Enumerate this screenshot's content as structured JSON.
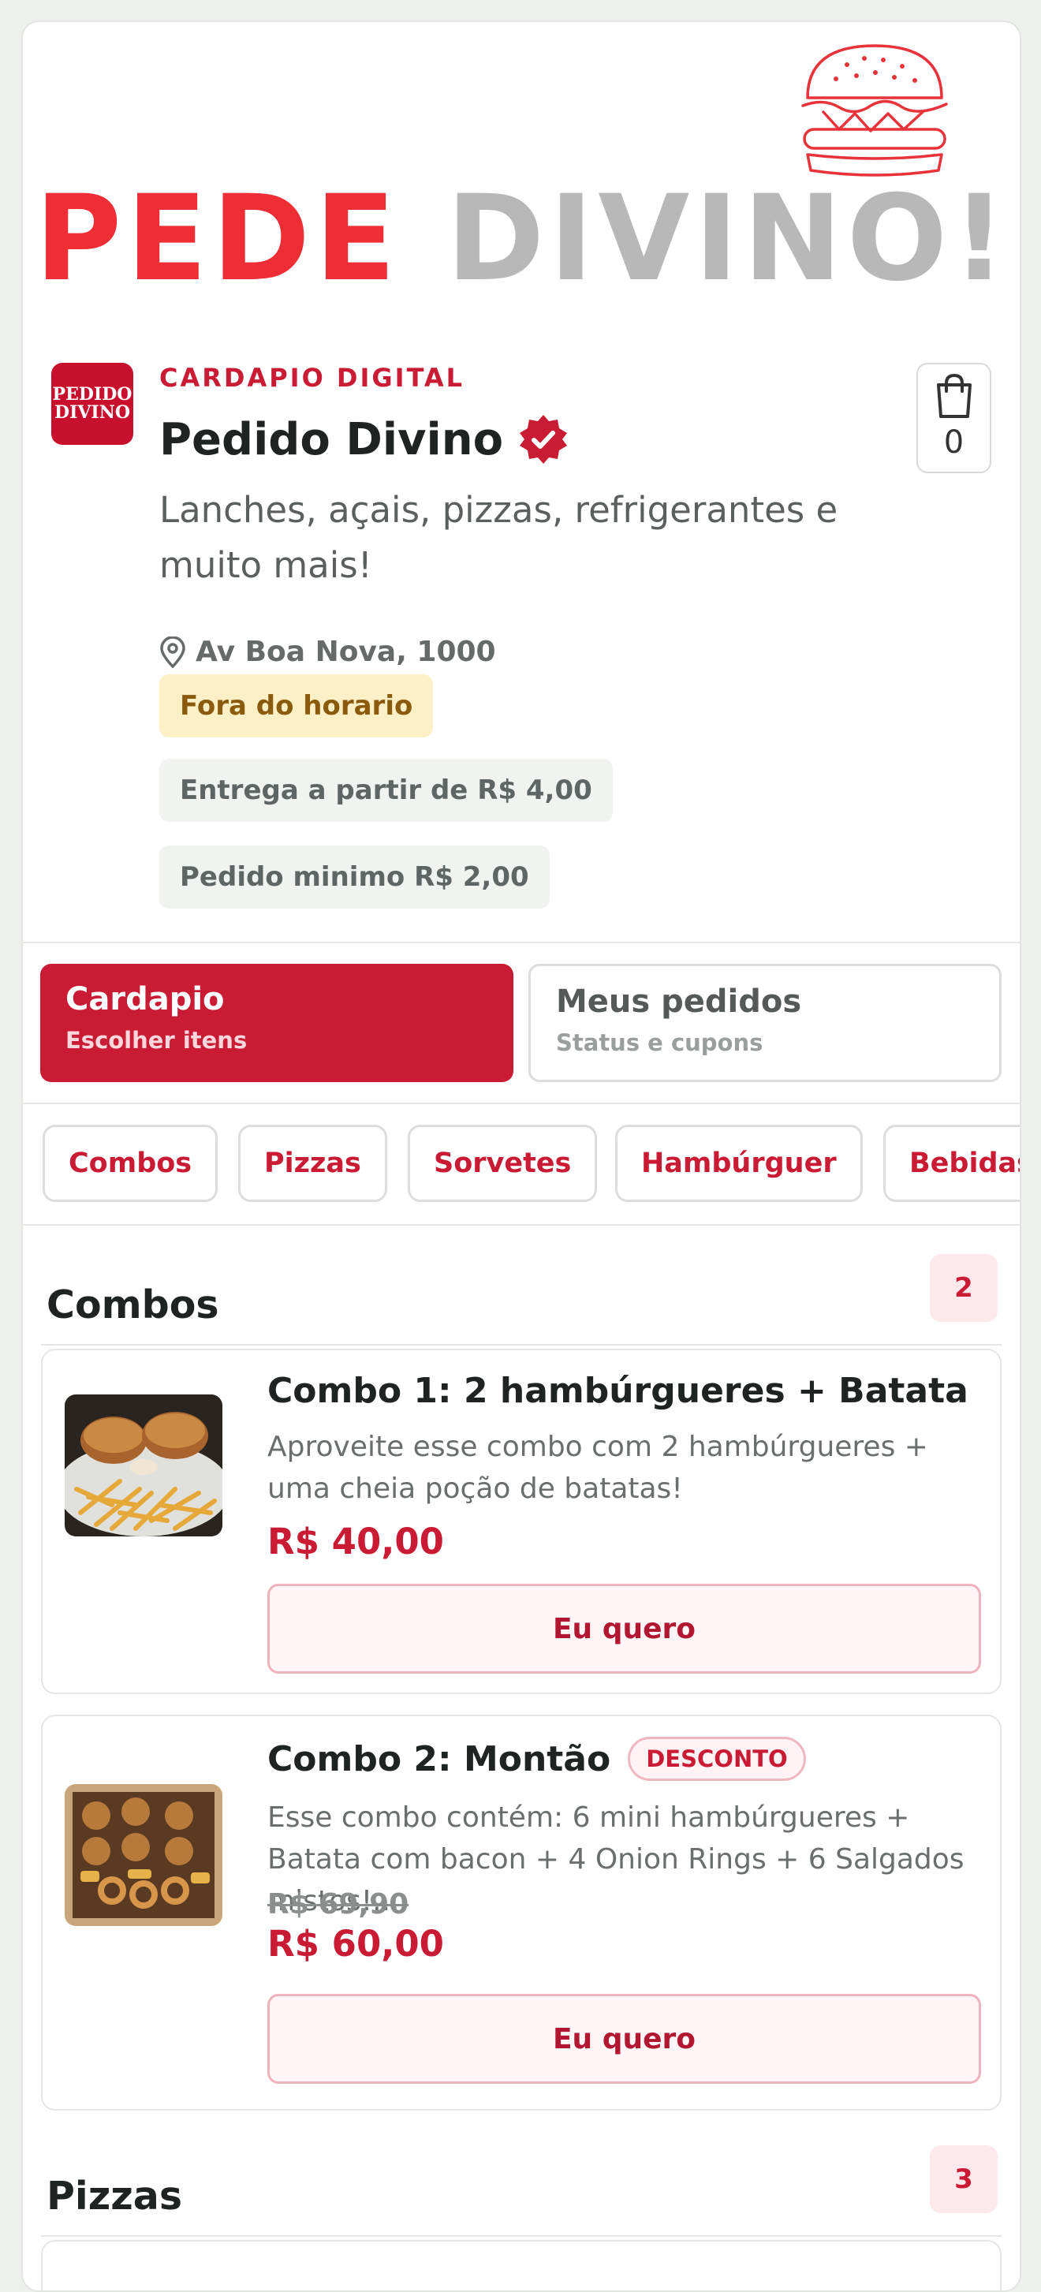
{
  "brand": {
    "word1": "PEDE",
    "word2": "DIVINO!",
    "red": "#ee2d35",
    "grey": "#b8b8b8",
    "logo_line1": "PEDIDO",
    "logo_line2": "DIVINO"
  },
  "store": {
    "eyebrow": "CARDAPIO DIGITAL",
    "name": "Pedido Divino",
    "description": "Lanches, açais, pizzas, refrigerantes e muito mais!",
    "address": "Av Boa Nova, 1000",
    "status": "Fora do horario",
    "delivery": "Entrega a partir de R$ 4,00",
    "minimum": "Pedido minimo R$ 2,00",
    "accent": "#c91b34"
  },
  "cart": {
    "count": "0",
    "icon": "shopping-bag-icon"
  },
  "tabs": [
    {
      "title": "Cardapio",
      "subtitle": "Escolher itens",
      "active": true
    },
    {
      "title": "Meus pedidos",
      "subtitle": "Status e cupons",
      "active": false
    }
  ],
  "categories": [
    "Combos",
    "Pizzas",
    "Sorvetes",
    "Hambúrguer",
    "Bebidas"
  ],
  "sections": [
    {
      "title": "Combos",
      "count": "2",
      "products": [
        {
          "name": "Combo 1: 2 hambúrgueres + Batata",
          "description": "Aproveite esse combo com 2 hambúrgueres + uma cheia poção de batatas!",
          "price": "R$ 40,00",
          "button": "Eu quero"
        },
        {
          "name": "Combo 2: Montão",
          "badge": "DESCONTO",
          "description": "Esse combo contém: 6 mini hambúrgueres + Batata com bacon + 4 Onion Rings + 6 Salgados mistos!...",
          "old_price": "R$ 69,90",
          "price": "R$ 60,00",
          "button": "Eu quero"
        }
      ]
    },
    {
      "title": "Pizzas",
      "count": "3"
    }
  ]
}
